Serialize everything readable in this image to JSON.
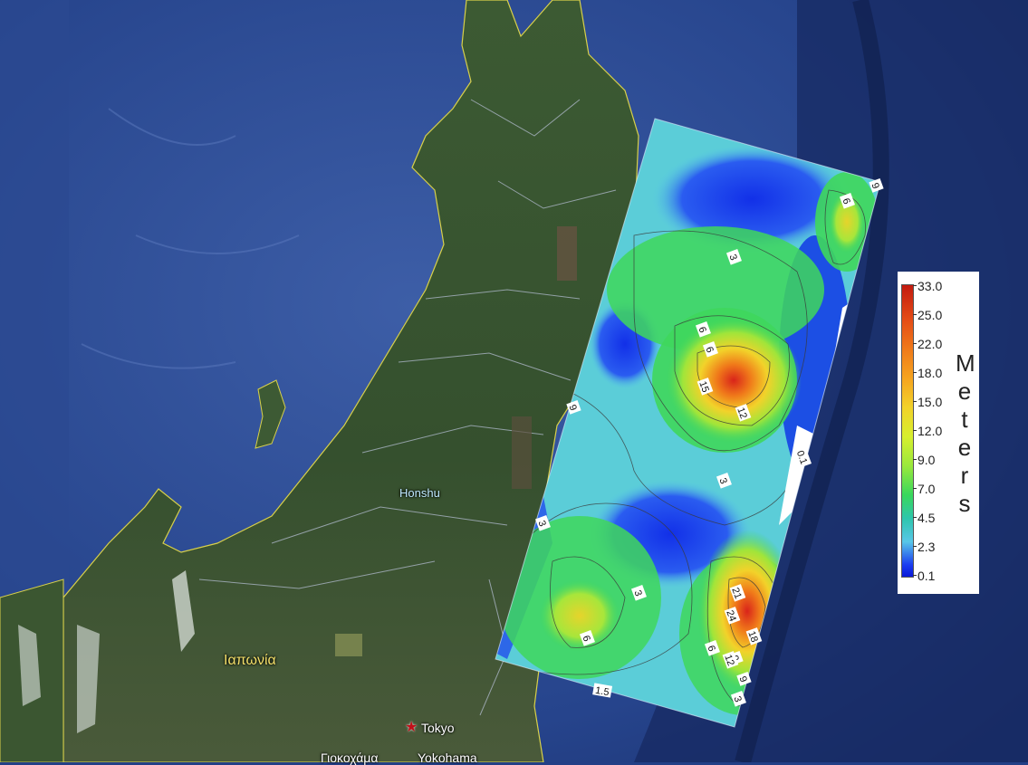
{
  "map": {
    "labels": {
      "honshu": "Honshu",
      "japan": "Ιαπωνία",
      "tokyo": "Tokyo",
      "yokohama": "Yokohama",
      "yokohama_greek": "Γιοκοχάμα"
    },
    "overlay": {
      "contour_labels": [
        "3",
        "3",
        "3",
        "3",
        "3",
        "6",
        "6",
        "6",
        "6",
        "6",
        "9",
        "9",
        "9",
        "9",
        "12",
        "12",
        "15",
        "18",
        "21",
        "24",
        "0.1",
        "1.5"
      ]
    },
    "legend": {
      "title": "Meters",
      "ticks": [
        "33.0",
        "25.0",
        "22.0",
        "18.0",
        "15.0",
        "12.0",
        "9.0",
        "7.0",
        "4.5",
        "2.3",
        "0.1"
      ],
      "colors": {
        "high": "#c31a0f",
        "mid_high": "#f07a1a",
        "mid": "#f2d22a",
        "mid_low": "#39d85c",
        "low_cyan": "#58c7e8",
        "low": "#0a18d8"
      }
    }
  }
}
